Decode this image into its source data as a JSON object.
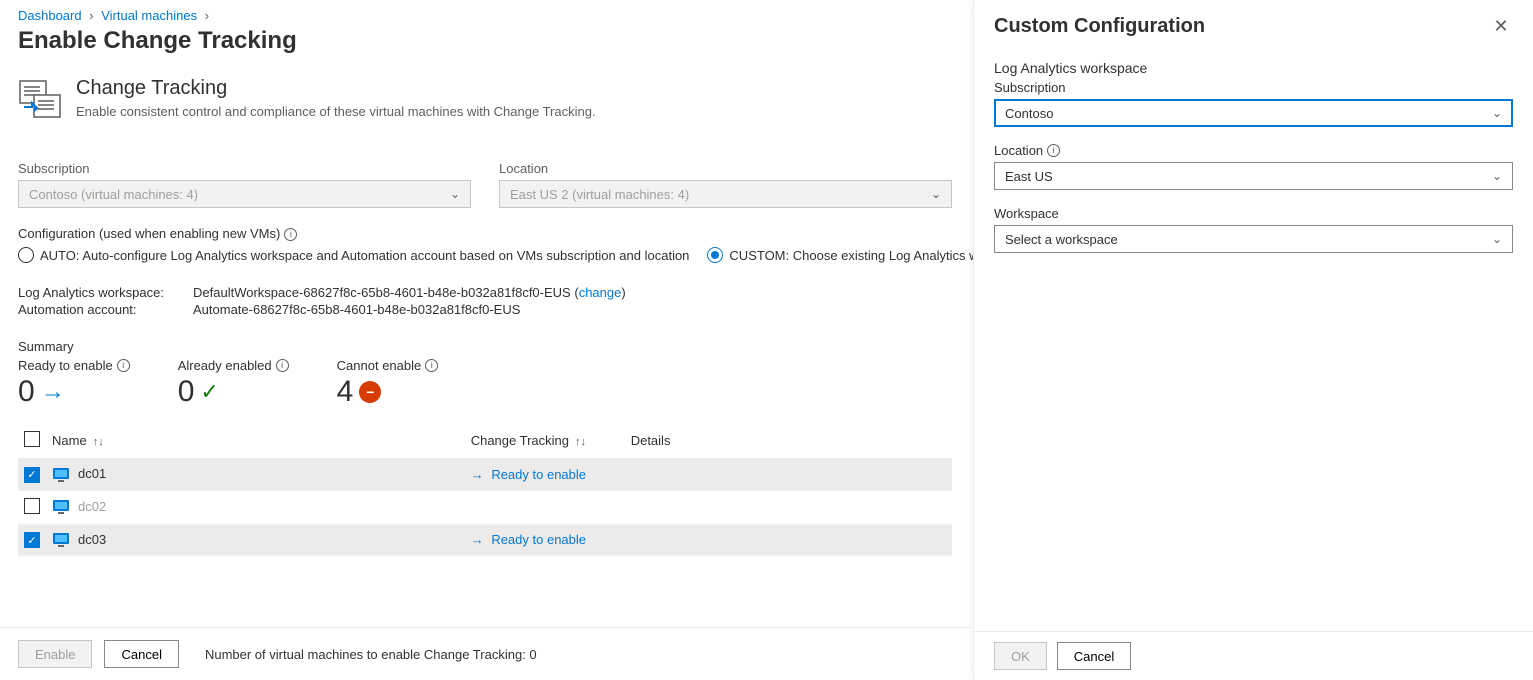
{
  "breadcrumb": {
    "dashboard": "Dashboard",
    "vms": "Virtual machines"
  },
  "page_title": "Enable Change Tracking",
  "hero": {
    "title": "Change Tracking",
    "desc": "Enable consistent control and compliance of these virtual machines with Change Tracking."
  },
  "filters": {
    "subscription_label": "Subscription",
    "subscription_value": "Contoso (virtual machines: 4)",
    "location_label": "Location",
    "location_value": "East US 2 (virtual machines: 4)"
  },
  "config": {
    "label": "Configuration (used when enabling new VMs)",
    "auto_label": "AUTO: Auto-configure Log Analytics workspace and Automation account based on VMs subscription and location",
    "custom_label": "CUSTOM: Choose existing Log Analytics workspa"
  },
  "workspace": {
    "la_key": "Log Analytics workspace:",
    "la_val": "DefaultWorkspace-68627f8c-65b8-4601-b48e-b032a81f8cf0-EUS",
    "la_change": "change",
    "auto_key": "Automation account:",
    "auto_val": "Automate-68627f8c-65b8-4601-b48e-b032a81f8cf0-EUS"
  },
  "summary": {
    "title": "Summary",
    "ready_label": "Ready to enable",
    "ready_count": "0",
    "already_label": "Already enabled",
    "already_count": "0",
    "cannot_label": "Cannot enable",
    "cannot_count": "4"
  },
  "table": {
    "name_hdr": "Name",
    "ct_hdr": "Change Tracking",
    "details_hdr": "Details",
    "rows": [
      {
        "checked": true,
        "name": "dc01",
        "status": "Ready to enable",
        "dim": false
      },
      {
        "checked": false,
        "name": "dc02",
        "status": "",
        "dim": true
      },
      {
        "checked": true,
        "name": "dc03",
        "status": "Ready to enable",
        "dim": false
      }
    ]
  },
  "footer": {
    "enable": "Enable",
    "cancel": "Cancel",
    "note": "Number of virtual machines to enable Change Tracking: 0"
  },
  "panel": {
    "title": "Custom Configuration",
    "la_hdr": "Log Analytics workspace",
    "sub_label": "Subscription",
    "sub_value": "Contoso",
    "loc_label": "Location",
    "loc_value": "East US",
    "ws_label": "Workspace",
    "ws_value": "Select a workspace",
    "ok": "OK",
    "cancel": "Cancel"
  }
}
